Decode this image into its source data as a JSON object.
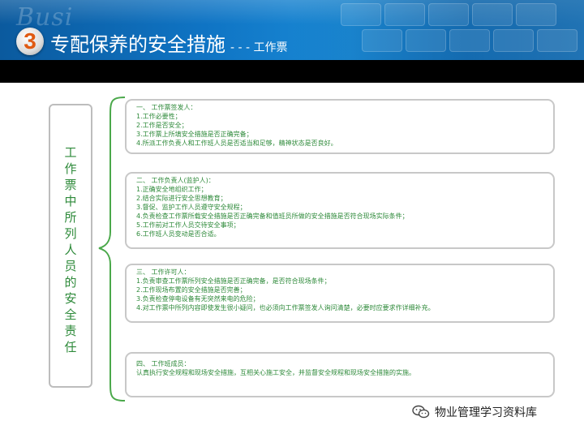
{
  "header": {
    "watermark": "Busi",
    "badge_number": "3",
    "title": "专配保养的安全措施",
    "title_suffix": "- - - 工作票"
  },
  "left_box": {
    "vertical_title": "工作票中所列人员的安全责任"
  },
  "sections": [
    {
      "title": "一、 工作票签发人：",
      "items": [
        "1.工作必要性；",
        "2.工作是否安全；",
        "3.工作票上所填安全措施是否正确完备；",
        "4.所派工作负责人和工作班人员是否适当和足够，精神状态是否良好。"
      ]
    },
    {
      "title": "二、 工作负责人(监护人)：",
      "items": [
        "1.正确安全地组织工作；",
        "2.结合实际进行安全思想教育；",
        "3.督促、监护工作人员遵守安全规程；",
        "4.负责检查工作票所载安全措施是否正确完备和值班员所做的安全措施是否符合现场实际条件；",
        "5.工作前对工作人员交待安全事项；",
        "6.工作班人员变动是否合适。"
      ]
    },
    {
      "title": "三、 工作许可人：",
      "items": [
        "1.负责审查工作票所列安全措施是否正确完备，是否符合现场条件；",
        "2.工作现场布置的安全措施是否完善；",
        "3.负责检查停电设备有无突然来电的危险；",
        "4.对工作票中所列内容即使发生很小疑问，也必须向工作票签发人询问清楚，必要时应要求作详细补充。"
      ]
    },
    {
      "title": "四、 工作班成员：",
      "items": [
        "认真执行安全规程和现场安全措施，互相关心施工安全，并监督安全规程和现场安全措施的实施。"
      ]
    }
  ],
  "footer": {
    "logo_icon": "wechat-icon",
    "text": "物业管理学习资料库"
  },
  "colors": {
    "header_blue": "#0f74c4",
    "text_green": "#2e8a3a",
    "brace_green": "#4aa84a",
    "border_gray": "#c8c8c8"
  }
}
